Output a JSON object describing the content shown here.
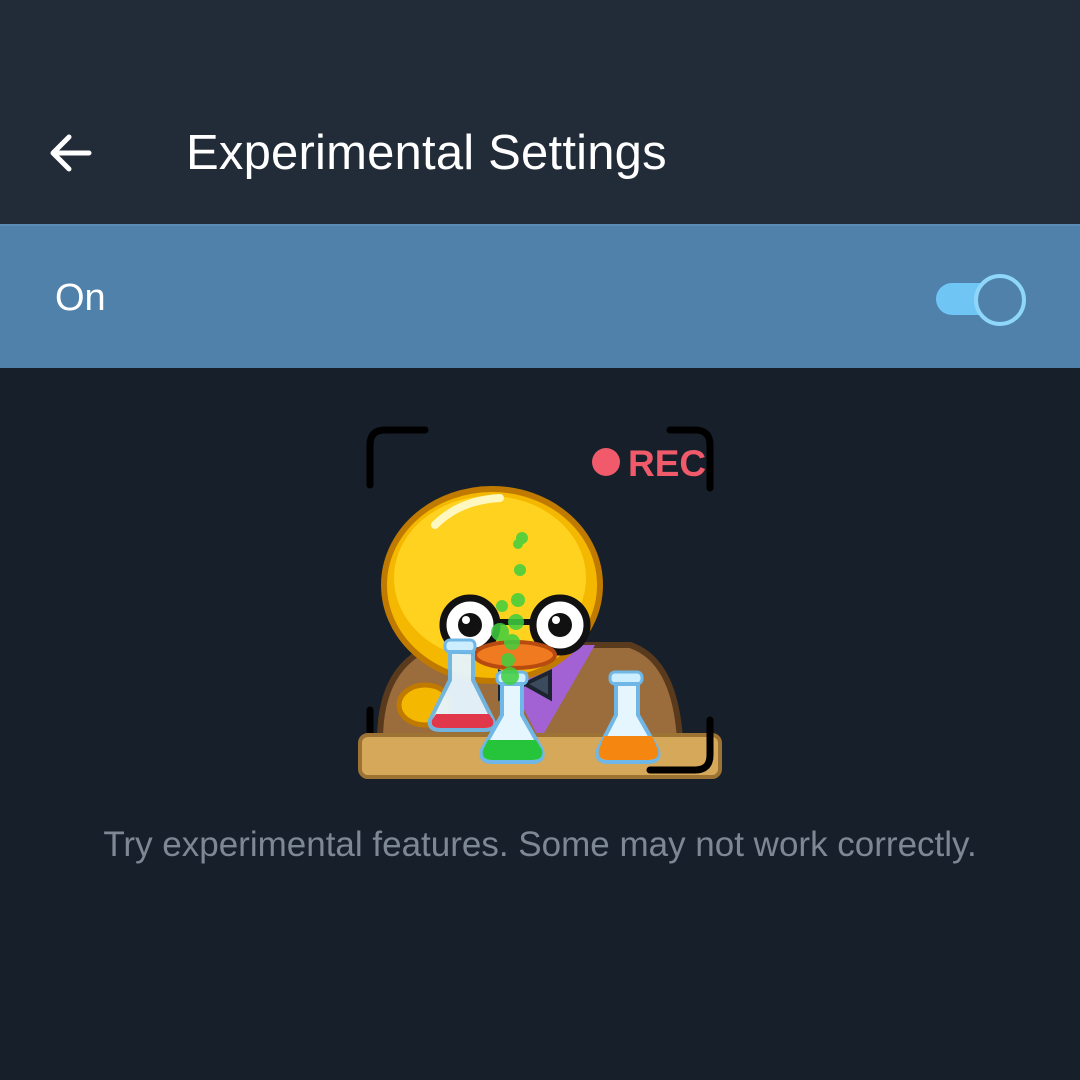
{
  "header": {
    "back_icon": "arrow-left-icon",
    "title": "Experimental Settings",
    "background_color": "#222b38"
  },
  "toggle": {
    "label": "On",
    "state": "on",
    "row_color": "#4f81ab",
    "track_color": "#6fc6f5"
  },
  "sticker": {
    "rec_label": "REC",
    "rec_color": "#f05a6a",
    "description_icon": "scientist-duck-sticker"
  },
  "caption": {
    "text": "Try experimental features. Some may not work correctly."
  }
}
